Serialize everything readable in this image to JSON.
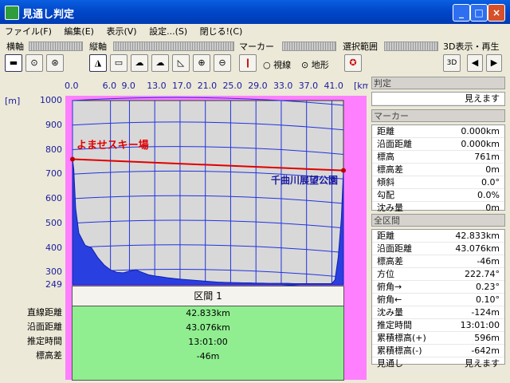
{
  "window": {
    "title": "見通し判定"
  },
  "menu": [
    "ファイル(F)",
    "編集(E)",
    "表示(V)",
    "設定...(S)",
    "閉じる!(C)"
  ],
  "toolbar": {
    "yoko_label": "横軸",
    "tate_label": "縦軸",
    "marker_label": "マーカー",
    "radio_visible": "視線",
    "radio_terrain": "地形",
    "range_label": "選択範囲",
    "play3d_label": "3D表示・再生",
    "btn3d": "3D"
  },
  "chart_data": {
    "type": "area",
    "title": "",
    "xunit": "[km]",
    "yunit": "[m]",
    "xticks": [
      "0.0",
      "6.0",
      "9.0",
      "13.0",
      "17.0",
      "21.0",
      "25.0",
      "29.0",
      "33.0",
      "37.0",
      "41.0"
    ],
    "yticks": [
      "1000",
      "900",
      "800",
      "700",
      "600",
      "500",
      "400",
      "300",
      "249"
    ],
    "xlim": [
      0,
      42.833
    ],
    "ylim": [
      249,
      1000
    ],
    "terrain": {
      "x": [
        0,
        0.2,
        0.5,
        1,
        2,
        3,
        4,
        5,
        6,
        7,
        8,
        9,
        10,
        11,
        12,
        13,
        14,
        15,
        16,
        17,
        18,
        19,
        20,
        21,
        22,
        23,
        24,
        25,
        26,
        27,
        28,
        29,
        30,
        31,
        32,
        33,
        34,
        35,
        36,
        37,
        38,
        39,
        40,
        41,
        41.5,
        42,
        42.5,
        42.833
      ],
      "y": [
        761,
        720,
        560,
        460,
        410,
        400,
        360,
        330,
        310,
        300,
        298,
        305,
        310,
        300,
        290,
        285,
        282,
        278,
        275,
        272,
        270,
        268,
        266,
        264,
        262,
        260,
        259,
        258,
        258,
        257,
        257,
        256,
        256,
        255,
        255,
        255,
        255,
        254,
        254,
        254,
        254,
        254,
        254,
        254,
        270,
        360,
        520,
        715
      ]
    },
    "sightline": {
      "x": [
        0,
        42.833
      ],
      "y": [
        761,
        715
      ]
    },
    "label_start": "よませスキー場",
    "label_end": "千曲川展望公園"
  },
  "section_title": "区間 1",
  "summary": {
    "labels": [
      "直線距離",
      "沿面距離",
      "推定時間",
      "標高差"
    ],
    "values": [
      "42.833km",
      "43.076km",
      "13:01:00",
      "-46m"
    ]
  },
  "right": {
    "hantei_header": "判定",
    "hantei_value": "見えます",
    "marker_header": "マーカー",
    "marker_rows": [
      {
        "k": "距離",
        "v": "0.000km"
      },
      {
        "k": "沿面距離",
        "v": "0.000km"
      },
      {
        "k": "標高",
        "v": "761m"
      },
      {
        "k": "標高差",
        "v": "0m"
      },
      {
        "k": "傾斜",
        "v": "0.0°"
      },
      {
        "k": "勾配",
        "v": "0.0%"
      },
      {
        "k": "沈み量",
        "v": "0m"
      }
    ],
    "all_header": "全区間",
    "all_rows": [
      {
        "k": "距離",
        "v": "42.833km"
      },
      {
        "k": "沿面距離",
        "v": "43.076km"
      },
      {
        "k": "標高差",
        "v": "-46m"
      },
      {
        "k": "方位",
        "v": "222.74°"
      },
      {
        "k": "俯角→",
        "v": "0.23°"
      },
      {
        "k": "俯角←",
        "v": "0.10°"
      },
      {
        "k": "沈み量",
        "v": "-124m"
      },
      {
        "k": "推定時間",
        "v": "13:01:00"
      },
      {
        "k": "累積標高(+)",
        "v": "596m"
      },
      {
        "k": "累積標高(-)",
        "v": "-642m"
      },
      {
        "k": "見通し",
        "v": "見えます"
      }
    ]
  }
}
